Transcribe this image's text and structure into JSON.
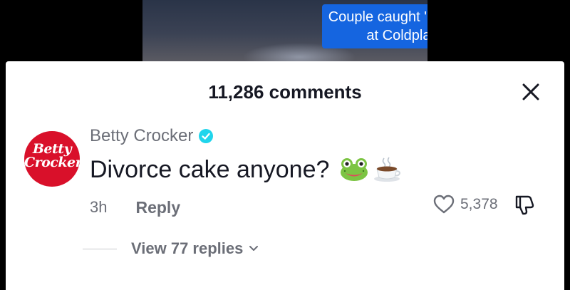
{
  "video": {
    "caption": "Couple caught 'having an affair' at Coldplay concert"
  },
  "comments_panel": {
    "title": "11,286 comments",
    "close_icon": "close-icon"
  },
  "comment": {
    "avatar_text_line1": "Betty",
    "avatar_text_line2": "Crocker",
    "avatar_color": "#d9102a",
    "username": "Betty Crocker",
    "verified_icon": "verified-badge-icon",
    "verified_color": "#20d5ec",
    "text": "Divorce cake anyone?",
    "emoji_1": "frog-emoji",
    "emoji_2": "coffee-emoji",
    "time": "3h",
    "reply_label": "Reply",
    "like_icon": "heart-icon",
    "like_count": "5,378",
    "dislike_icon": "thumbs-down-icon"
  },
  "replies": {
    "label": "View 77 replies",
    "chevron_icon": "chevron-down-icon"
  }
}
